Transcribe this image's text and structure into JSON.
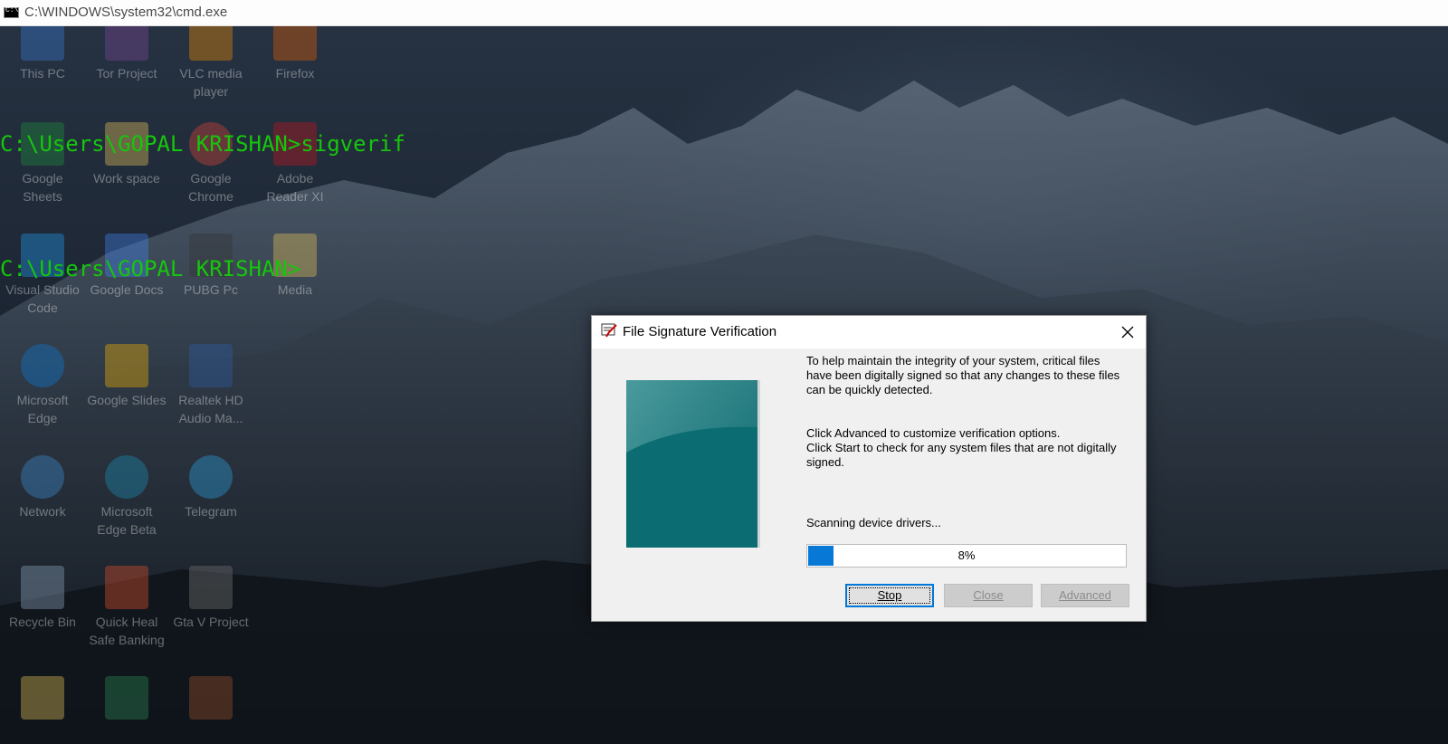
{
  "cmd": {
    "title": "C:\\WINDOWS\\system32\\cmd.exe",
    "icon_text": "C:\\",
    "lines": [
      "C:\\Users\\GOPAL KRISHAN>sigverif",
      "C:\\Users\\GOPAL KRISHAN>"
    ],
    "text_color": "#16c60c"
  },
  "desktop_icons": [
    {
      "label": "This PC",
      "color": "#3a7bd5"
    },
    {
      "label": "Tor Project",
      "color": "#7d4698"
    },
    {
      "label": "VLC media player",
      "color": "#f08a00"
    },
    {
      "label": "Firefox",
      "color": "#e66000"
    },
    {
      "label": "Google Sheets",
      "color": "#1e8e3e"
    },
    {
      "label": "Work space",
      "color": "#e8c45a"
    },
    {
      "label": "Google Chrome",
      "color": "#db4437"
    },
    {
      "label": "Adobe Reader XI",
      "color": "#c4161c"
    },
    {
      "label": "Visual Studio Code",
      "color": "#1f9cf0"
    },
    {
      "label": "Google Docs",
      "color": "#4285f4"
    },
    {
      "label": "PUBG Pc",
      "color": "#333333"
    },
    {
      "label": "Media",
      "color": "#e8c45a"
    },
    {
      "label": "Microsoft Edge",
      "color": "#0c7bd6"
    },
    {
      "label": "Google Slides",
      "color": "#f4b400"
    },
    {
      "label": "Realtek HD Audio Ma...",
      "color": "#2b5fa8"
    },
    {
      "label": "Network",
      "color": "#3c8fd6"
    },
    {
      "label": "Microsoft Edge Beta",
      "color": "#1b8fb8"
    },
    {
      "label": "Telegram",
      "color": "#2aa3e0"
    },
    {
      "label": "Recycle Bin",
      "color": "#8fa8c0"
    },
    {
      "label": "Quick Heal Safe Banking",
      "color": "#e2502a"
    },
    {
      "label": "Gta V Project",
      "color": "#777777"
    },
    {
      "label": "",
      "color": "#e8c45a"
    },
    {
      "label": "",
      "color": "#2e8b57"
    },
    {
      "label": "",
      "color": "#a0522d"
    }
  ],
  "dialog": {
    "title": "File Signature Verification",
    "paragraph1": [
      "To help maintain the integrity of your system, critical files",
      "have been digitally signed so that any changes to these files",
      "can be quickly detected."
    ],
    "paragraph2": [
      "Click Advanced to customize verification options.",
      "Click Start to check for any system files that are not digitally",
      "signed."
    ],
    "status": "Scanning device drivers...",
    "progress_percent": 8,
    "progress_label": "8%",
    "buttons": {
      "stop": "Stop",
      "close": "Close",
      "advanced": "Advanced"
    },
    "accent_color": "#0078d7"
  }
}
